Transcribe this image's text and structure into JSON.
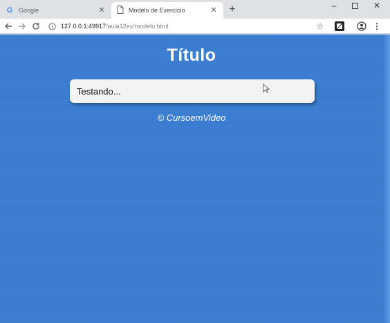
{
  "browser": {
    "tabs": [
      {
        "title": "Google",
        "favicon": "google-g-icon",
        "active": false
      },
      {
        "title": "Modelo de Exercício",
        "favicon": "document-icon",
        "active": true
      }
    ],
    "url": {
      "host": "127.0.0.1:49917",
      "path": "/aula12ex/modelo.html"
    }
  },
  "page": {
    "title": "Título",
    "textbox_value": "Testando...",
    "footer": "© CursoemVideo"
  },
  "colors": {
    "page_background": "#3a7dd0",
    "text_box": "#f3f3f3",
    "tab_strip": "#dee1e6"
  }
}
